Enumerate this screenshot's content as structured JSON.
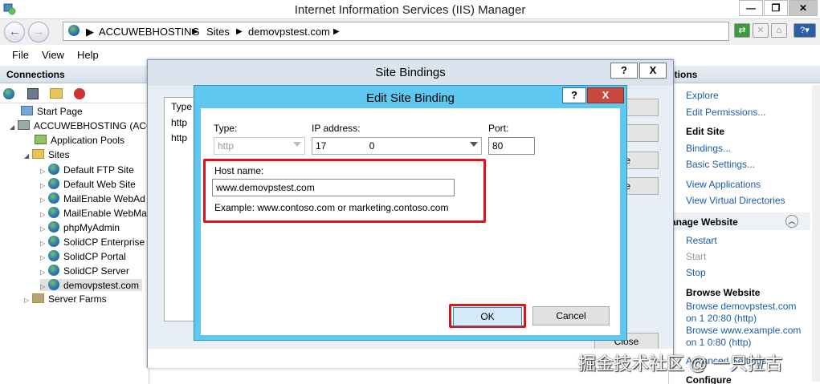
{
  "window": {
    "title": "Internet Information Services (IIS) Manager",
    "minimize": "—",
    "maximize": "❐",
    "close": "✕"
  },
  "address": {
    "segments": [
      "ACCUWEBHOSTING",
      "Sites",
      "demovpstest.com"
    ],
    "separator": "▶"
  },
  "menu": {
    "items": [
      "File",
      "View",
      "Help"
    ]
  },
  "connections": {
    "title": "Connections",
    "tree": [
      {
        "label": "Start Page"
      },
      {
        "label": "ACCUWEBHOSTING (ACC"
      },
      {
        "label": "Application Pools"
      },
      {
        "label": "Sites"
      },
      {
        "label": "Default FTP Site"
      },
      {
        "label": "Default Web Site"
      },
      {
        "label": "MailEnable WebAd"
      },
      {
        "label": "MailEnable WebMa"
      },
      {
        "label": "phpMyAdmin"
      },
      {
        "label": "SolidCP Enterprise"
      },
      {
        "label": "SolidCP Portal"
      },
      {
        "label": "SolidCP Server"
      },
      {
        "label": "demovpstest.com"
      },
      {
        "label": "Server Farms"
      }
    ]
  },
  "actions": {
    "title": "ctions",
    "explore": "Explore",
    "edit_permissions": "Edit Permissions...",
    "edit_site": "Edit Site",
    "bindings": "Bindings...",
    "basic_settings": "Basic Settings...",
    "view_applications": "View Applications",
    "view_virtual_directories": "View Virtual Directories",
    "manage_website": "anage Website",
    "restart": "Restart",
    "start": "Start",
    "stop": "Stop",
    "browse_website": "Browse Website",
    "browse_1": "Browse demovpstest.com",
    "browse_1_port": "on 1              20:80 (http)",
    "browse_2": "Browse www.example.com",
    "browse_2_port": "on 1               0:80 (http)",
    "advanced_settings": "Advanced Settings...",
    "configure": "Configure"
  },
  "site_bindings": {
    "title": "Site Bindings",
    "help": "?",
    "close": "X",
    "column_type": "Type",
    "rows": [
      "http",
      "http"
    ],
    "side_buttons": [
      "",
      "",
      "e",
      "e"
    ],
    "close_button": "Close"
  },
  "edit_binding": {
    "title": "Edit Site Binding",
    "help": "?",
    "close": "X",
    "type_label": "Type:",
    "type_value": "http",
    "ip_label": "IP address:",
    "ip_value": "17                0",
    "port_label": "Port:",
    "port_value": "80",
    "host_label": "Host name:",
    "host_value": "www.demovpstest.com",
    "example": "Example: www.contoso.com or marketing.contoso.com",
    "ok": "OK",
    "cancel": "Cancel"
  },
  "watermark": "掘金技术社区 @ 一只拉古",
  "colors": {
    "accent_blue": "#5ec8f0",
    "highlight_red": "#e0131d",
    "link_blue": "#1a5da6"
  }
}
